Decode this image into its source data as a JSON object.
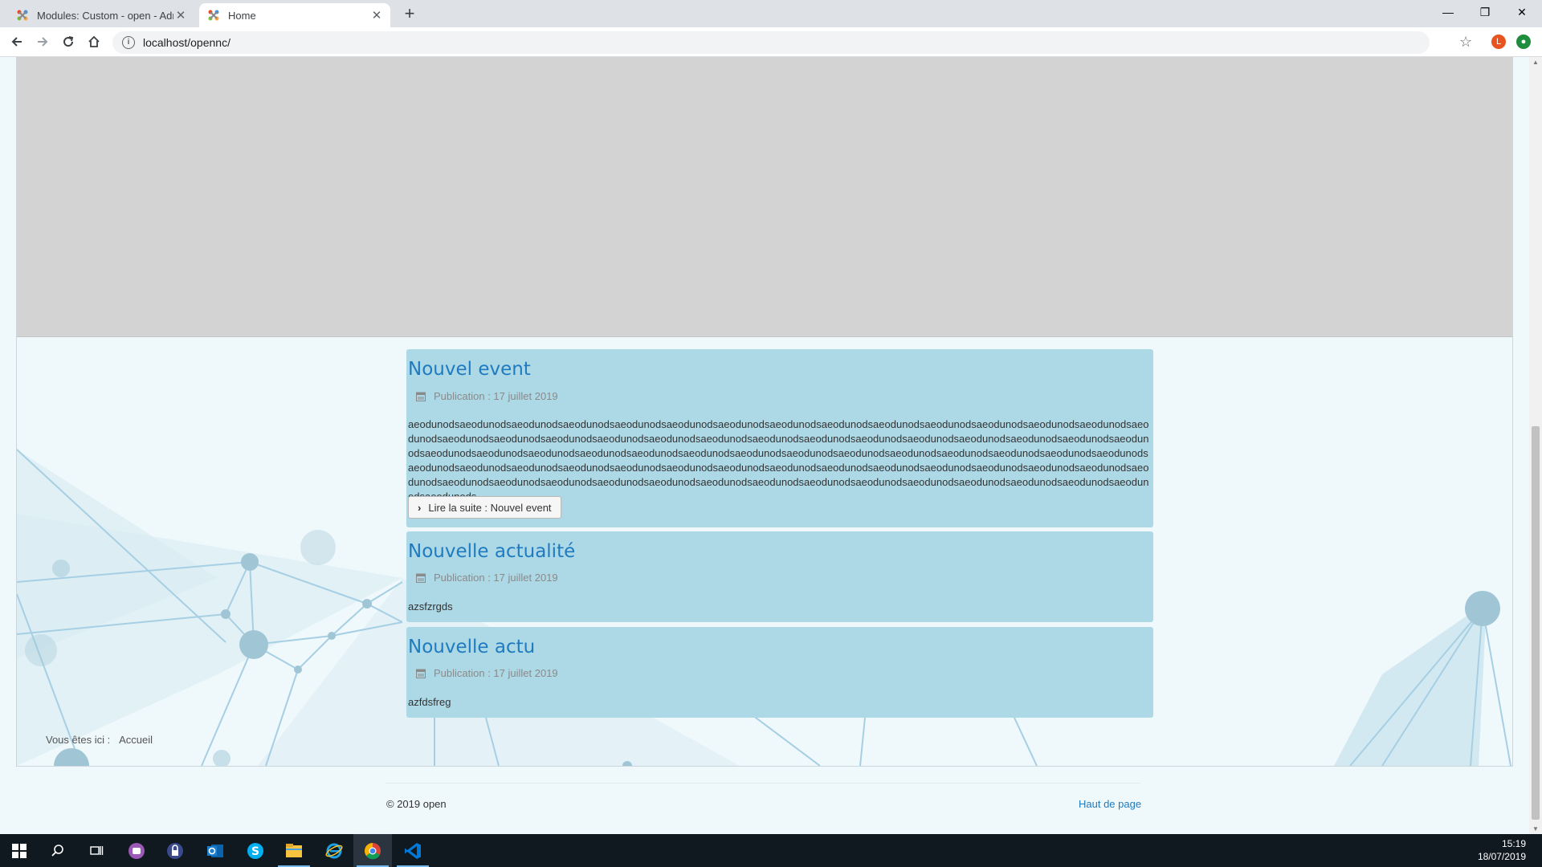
{
  "browser": {
    "tabs": [
      {
        "title": "Modules: Custom - open - Admin",
        "active": false
      },
      {
        "title": "Home",
        "active": true
      }
    ],
    "new_tab_label": "+",
    "url": "localhost/opennc/",
    "profile_initial": "L"
  },
  "page": {
    "articles": [
      {
        "title": "Nouvel event",
        "meta": "Publication : 17 juillet 2019",
        "body": "aeodunodsaeodunodsaeodunodsaeodunodsaeodunodsaeodunodsaeodunodsaeodunodsaeodunodsaeodunodsaeodunodsaeodunodsaeodunodsaeodunodsaeodunodsaeodunodsaeodunodsaeodunodsaeodunodsaeodunodsaeodunodsaeodunodsaeodunodsaeodunodsaeodunodsaeodunodsaeodunodsaeodunodsaeodunodsaeodunodsaeodunodsaeodunodsaeodunodsaeodunodsaeodunodsaeodunodsaeodunodsaeodunodsaeodunodsaeodunodsaeodunodsaeodunodsaeodunodsaeodunodsaeodunodsaeodunodsaeodunodsaeodunodsaeodunodsaeodunodsaeodunodsaeodunodsaeodunodsaeodunodsaeodunodsaeodunodsaeodunodsaeodunodsaeodunodsaeodunodsaeodunodsaeodunodsaeodunodsaeodunodsaeodunodsaeodunodsaeodunodsaeodunodsaeodunodsaeodunodsaeodunodsaeodunodsaeodunods",
        "read_more": "Lire la suite : Nouvel event"
      },
      {
        "title": "Nouvelle actualité",
        "meta": "Publication : 17 juillet 2019",
        "body": "azsfzrgds"
      },
      {
        "title": "Nouvelle actu",
        "meta": "Publication : 17 juillet 2019",
        "body": "azfdsfreg"
      }
    ],
    "breadcrumb": {
      "label": "Vous êtes ici :",
      "home": "Accueil"
    },
    "footer": {
      "copyright": "© 2019 open",
      "back_to_top": "Haut de page"
    }
  },
  "taskbar": {
    "apps": [
      "windows-start",
      "search",
      "task-view",
      "app-purple",
      "app-lock",
      "outlook",
      "skype",
      "file-explorer",
      "internet-explorer",
      "chrome",
      "vscode"
    ],
    "time": "15:19",
    "date": "18/07/2019"
  },
  "colors": {
    "article_bg": "#add8e6",
    "title_blue": "#1f7bbf",
    "page_bg": "#eff8fb",
    "banner_gray": "#d3d3d3",
    "taskbar": "#101820"
  }
}
